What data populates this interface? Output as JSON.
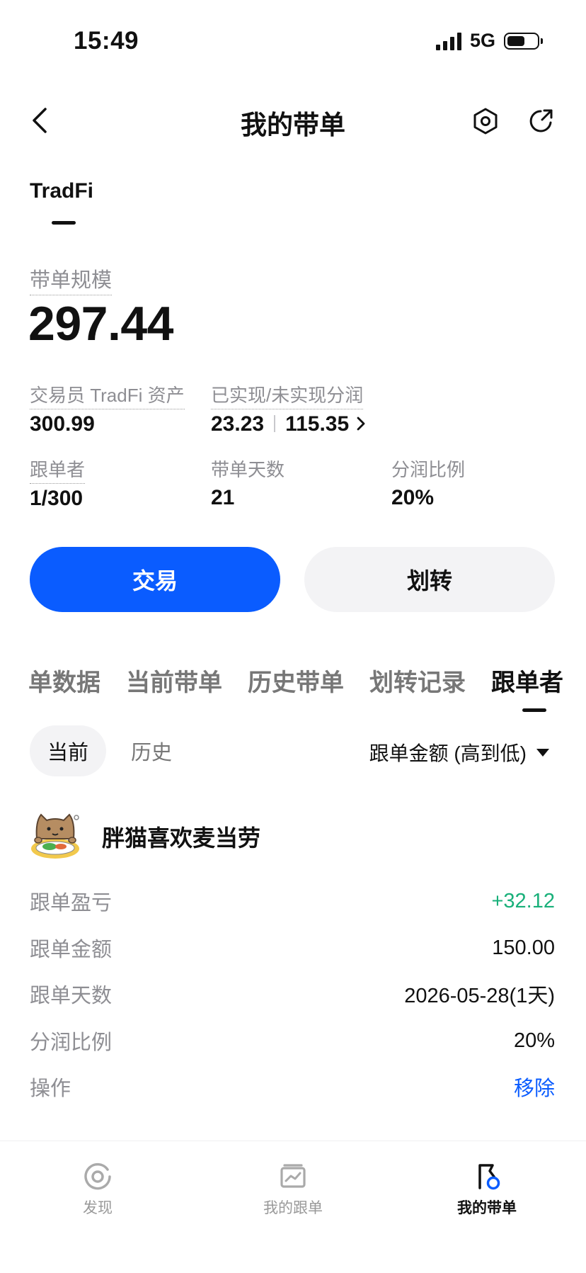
{
  "status": {
    "time": "15:49",
    "network": "5G"
  },
  "header": {
    "title": "我的带单"
  },
  "account_tab": "TradFi",
  "summary": {
    "scale_label": "带单规模",
    "scale_value": "297.44",
    "trader_assets_label": "交易员 TradFi 资产",
    "trader_assets_value": "300.99",
    "profit_share_label": "已实现/未实现分润",
    "realized": "23.23",
    "unrealized": "115.35",
    "followers_label": "跟单者",
    "followers_value": "1/300",
    "days_label": "带单天数",
    "days_value": "21",
    "ratio_label": "分润比例",
    "ratio_value": "20%"
  },
  "actions": {
    "trade": "交易",
    "transfer": "划转"
  },
  "tabs": [
    {
      "label": "单数据",
      "active": false
    },
    {
      "label": "当前带单",
      "active": false
    },
    {
      "label": "历史带单",
      "active": false
    },
    {
      "label": "划转记录",
      "active": false
    },
    {
      "label": "跟单者",
      "active": true
    }
  ],
  "segments": {
    "current": "当前",
    "history": "历史"
  },
  "sort_label": "跟单金额 (高到低)",
  "follower": {
    "name": "胖猫喜欢麦当劳",
    "rows": [
      {
        "label": "跟单盈亏",
        "value": "+32.12",
        "color": "#19b07a"
      },
      {
        "label": "跟单金额",
        "value": "150.00"
      },
      {
        "label": "跟单天数",
        "value": "2026-05-28(1天)"
      },
      {
        "label": "分润比例",
        "value": "20%"
      },
      {
        "label": "操作",
        "value": "移除",
        "color": "#0a5cff"
      }
    ]
  },
  "bottom_nav": [
    {
      "label": "发现",
      "icon": "discover-icon",
      "active": false
    },
    {
      "label": "我的跟单",
      "icon": "chart-card-icon",
      "active": false
    },
    {
      "label": "我的带单",
      "icon": "flag-icon",
      "active": true
    }
  ],
  "colors": {
    "accent": "#0a5cff",
    "profit": "#19b07a"
  }
}
